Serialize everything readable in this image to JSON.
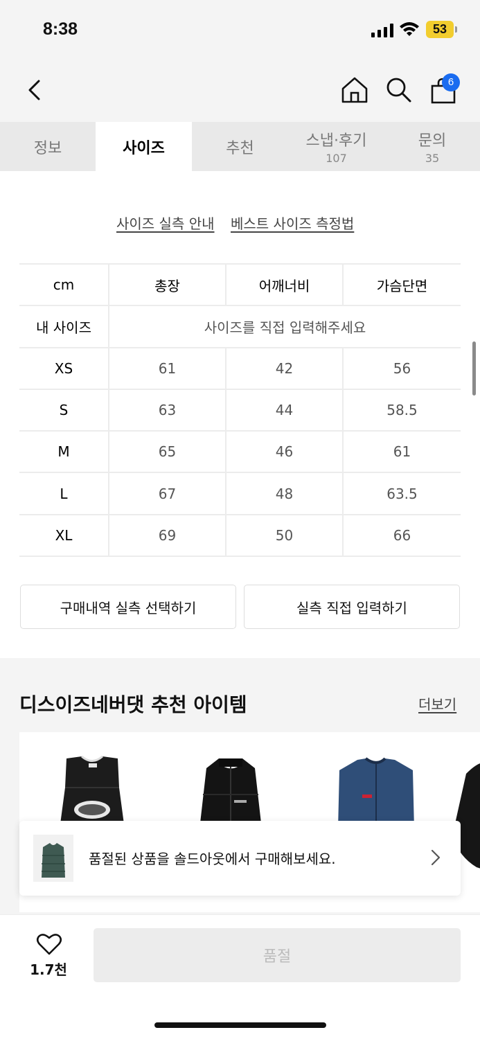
{
  "status_bar": {
    "time": "8:38",
    "battery": "53"
  },
  "nav": {
    "cart_count": "6"
  },
  "tabs": [
    {
      "label": "정보",
      "count": ""
    },
    {
      "label": "사이즈",
      "count": ""
    },
    {
      "label": "추천",
      "count": ""
    },
    {
      "label": "스냅·후기",
      "count": "107"
    },
    {
      "label": "문의",
      "count": "35"
    }
  ],
  "size_links": {
    "guide": "사이즈 실측 안내",
    "best": "베스트 사이즈 측정법"
  },
  "size_table": {
    "headers": [
      "cm",
      "총장",
      "어깨너비",
      "가슴단면"
    ],
    "my_size_label": "내 사이즈",
    "my_size_placeholder": "사이즈를 직접 입력해주세요",
    "rows": [
      {
        "size": "XS",
        "length": "61",
        "shoulder": "42",
        "chest": "56"
      },
      {
        "size": "S",
        "length": "63",
        "shoulder": "44",
        "chest": "58.5"
      },
      {
        "size": "M",
        "length": "65",
        "shoulder": "46",
        "chest": "61"
      },
      {
        "size": "L",
        "length": "67",
        "shoulder": "48",
        "chest": "63.5"
      },
      {
        "size": "XL",
        "length": "69",
        "shoulder": "50",
        "chest": "66"
      }
    ]
  },
  "buttons": {
    "select_history": "구매내역 실측 선택하기",
    "direct_input": "실측 직접 입력하기"
  },
  "recommend": {
    "title": "디스이즈네버댓 추천 아이템",
    "more": "더보기"
  },
  "soldout_banner": {
    "text": "품절된 상품을 솔드아웃에서 구매해보세요."
  },
  "bottom": {
    "like_count": "1.7천",
    "buy_label": "품절"
  },
  "colors": {
    "accent": "#1a6cf0",
    "battery": "#f2cd2e"
  }
}
